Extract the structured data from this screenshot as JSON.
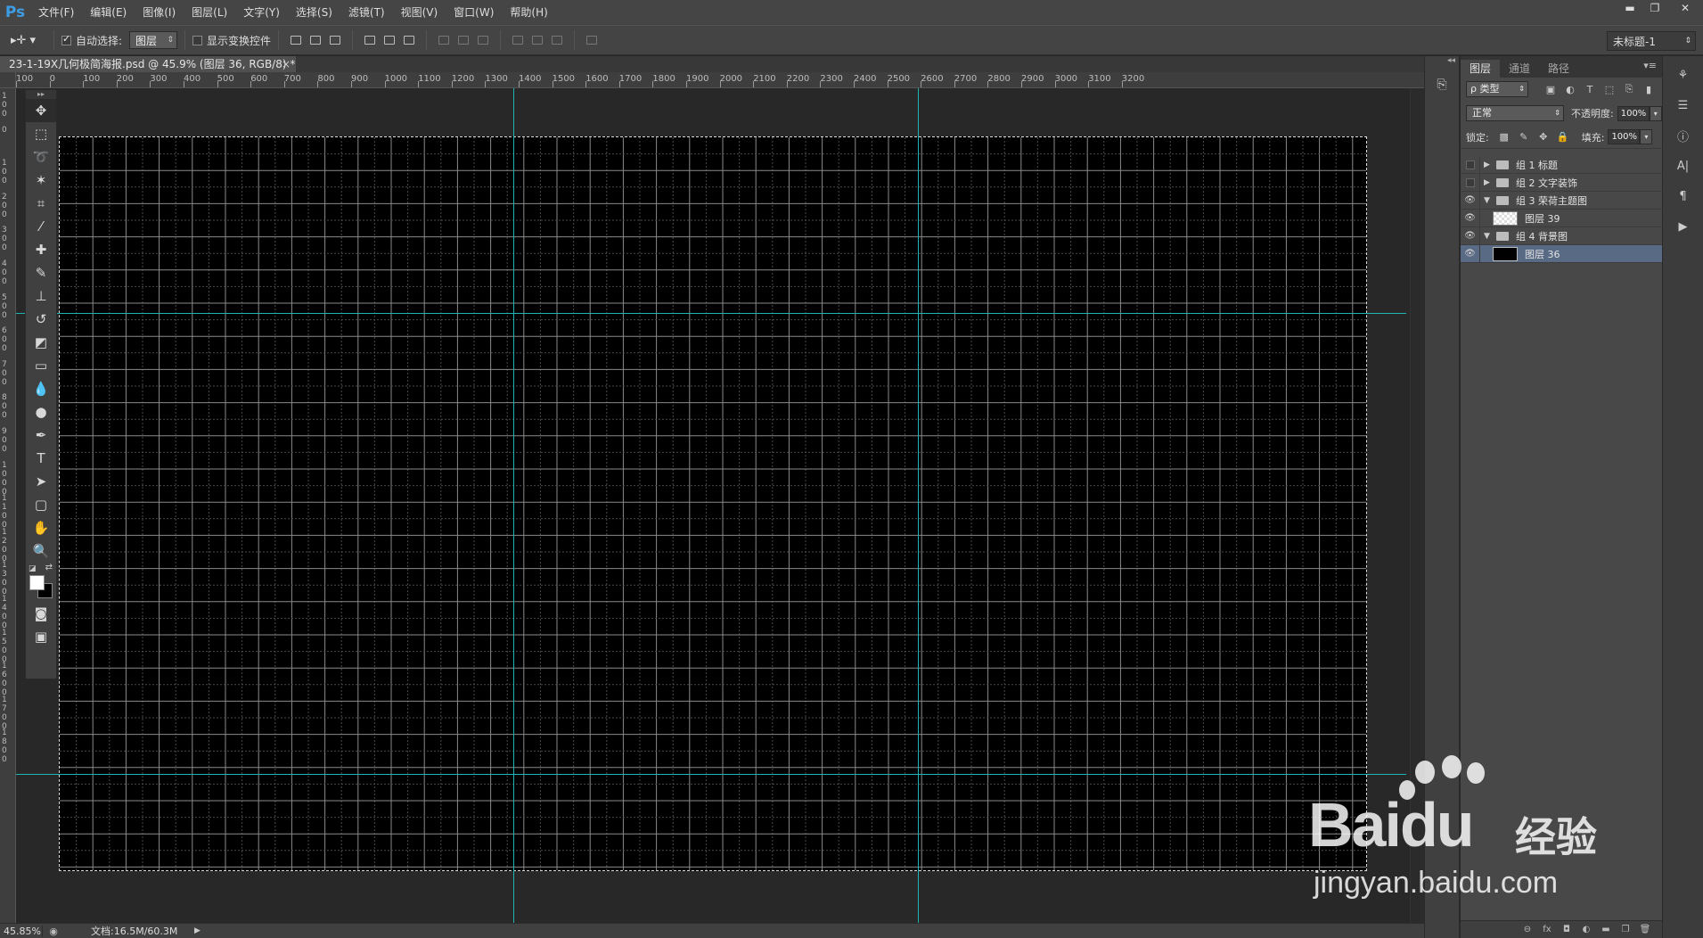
{
  "app": {
    "logo": "Ps"
  },
  "menu": [
    "文件(F)",
    "编辑(E)",
    "图像(I)",
    "图层(L)",
    "文字(Y)",
    "选择(S)",
    "滤镜(T)",
    "视图(V)",
    "窗口(W)",
    "帮助(H)"
  ],
  "window_controls": {
    "minimize": "▬",
    "restore": "❐",
    "close": "✕"
  },
  "options": {
    "tool_icon": "move-tool-icon",
    "tool_glyph": "▸✛ ▾",
    "auto_select_label": "自动选择:",
    "auto_select_checked": true,
    "auto_select_value": "图层",
    "show_transform_label": "显示变换控件",
    "show_transform_checked": false,
    "workspace": "未标题-1"
  },
  "document": {
    "tab_title": "23-1-19X几何极简海报.psd @ 45.9% (图层 36, RGB/8) *",
    "tab_close": "×"
  },
  "ruler": {
    "h_labels": [
      "100",
      "0",
      "100",
      "200",
      "300",
      "400",
      "500",
      "600",
      "700",
      "800",
      "900",
      "1000",
      "1100",
      "1200",
      "1300",
      "1400",
      "1500",
      "1600",
      "1700",
      "1800",
      "1900",
      "2000",
      "2100",
      "2200",
      "2300",
      "2400",
      "2500",
      "2600",
      "2700",
      "2800",
      "2900",
      "3000",
      "3100",
      "3200"
    ],
    "v_labels": [
      "100",
      "0",
      "100",
      "200",
      "300",
      "400",
      "500",
      "600",
      "700",
      "800",
      "900",
      "1000",
      "1100",
      "1200",
      "1300",
      "1400",
      "1500",
      "1600",
      "1700",
      "1800"
    ]
  },
  "status": {
    "zoom": "45.85%",
    "doc_size": "文档:16.5M/60.3M"
  },
  "layers_panel": {
    "tabs": [
      "图层",
      "通道",
      "路径"
    ],
    "filter_kind": "ρ 类型",
    "blend_mode": "正常",
    "opacity_label": "不透明度:",
    "opacity": "100%",
    "lock_label": "锁定:",
    "fill_label": "填充:",
    "fill": "100%",
    "layers": [
      {
        "name": "组 1 标题",
        "type": "group",
        "visible": false,
        "expanded": false,
        "selected": false
      },
      {
        "name": "组 2 文字装饰",
        "type": "group",
        "visible": false,
        "expanded": false,
        "selected": false
      },
      {
        "name": "组 3 荣荷主题图",
        "type": "group",
        "visible": true,
        "expanded": true,
        "selected": false
      },
      {
        "name": "图层 39",
        "type": "layer",
        "thumb": "transparent",
        "visible": true,
        "selected": false
      },
      {
        "name": "组 4 背景图",
        "type": "group",
        "visible": true,
        "expanded": true,
        "selected": false
      },
      {
        "name": "图层 36",
        "type": "layer",
        "thumb": "black",
        "visible": true,
        "selected": true
      }
    ],
    "footer_icons": [
      "link-icon",
      "fx-icon",
      "mask-icon",
      "adjustment-icon",
      "group-icon",
      "new-layer-icon",
      "trash-icon"
    ]
  },
  "watermark": {
    "brand": "Bai",
    "brand2": "du",
    "cn": "经验",
    "url": "jingyan.baidu.com"
  },
  "colors": {
    "guide": "#1fb3b3",
    "selected_layer": "#596a84",
    "ps_blue": "#3d9ce4"
  }
}
